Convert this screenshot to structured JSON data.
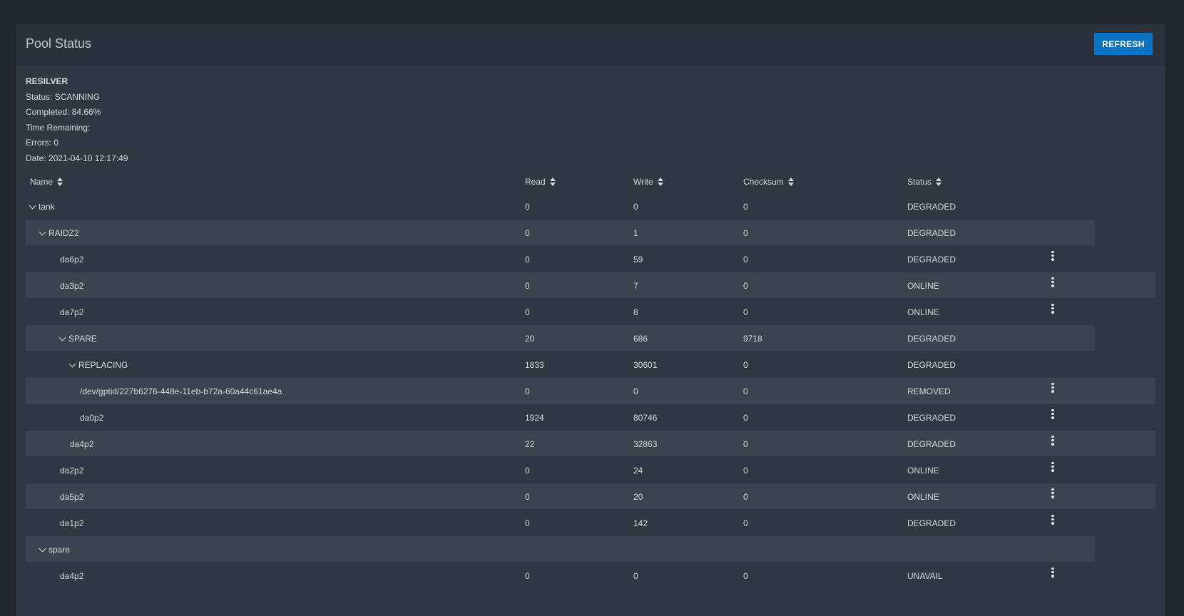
{
  "card": {
    "title": "Pool Status",
    "refresh_label": "REFRESH"
  },
  "scan": {
    "title": "RESILVER",
    "status": "Status: SCANNING",
    "completed": "Completed: 84.66%",
    "time_remaining": "Time Remaining:",
    "errors": "Errors: 0",
    "date": "Date: 2021-04-10 12:17:49"
  },
  "table": {
    "columns": [
      "Name",
      "Read",
      "Write",
      "Checksum",
      "Status"
    ],
    "rows": [
      {
        "name": "tank",
        "read": "0",
        "write": "0",
        "checksum": "0",
        "status": "DEGRADED",
        "depth": 0,
        "expandable": true,
        "menu": false,
        "striped": false,
        "wide": false
      },
      {
        "name": "RAIDZ2",
        "read": "0",
        "write": "1",
        "checksum": "0",
        "status": "DEGRADED",
        "depth": 1,
        "expandable": true,
        "menu": false,
        "striped": true,
        "wide": false
      },
      {
        "name": "da6p2",
        "read": "0",
        "write": "59",
        "checksum": "0",
        "status": "DEGRADED",
        "depth": 2,
        "expandable": false,
        "menu": true,
        "striped": false,
        "wide": true
      },
      {
        "name": "da3p2",
        "read": "0",
        "write": "7",
        "checksum": "0",
        "status": "ONLINE",
        "depth": 2,
        "expandable": false,
        "menu": true,
        "striped": true,
        "wide": true
      },
      {
        "name": "da7p2",
        "read": "0",
        "write": "8",
        "checksum": "0",
        "status": "ONLINE",
        "depth": 2,
        "expandable": false,
        "menu": true,
        "striped": false,
        "wide": true
      },
      {
        "name": "SPARE",
        "read": "20",
        "write": "686",
        "checksum": "9718",
        "status": "DEGRADED",
        "depth": 2,
        "expandable": true,
        "menu": false,
        "striped": true,
        "wide": false
      },
      {
        "name": "REPLACING",
        "read": "1833",
        "write": "30601",
        "checksum": "0",
        "status": "DEGRADED",
        "depth": 3,
        "expandable": true,
        "menu": false,
        "striped": false,
        "wide": false
      },
      {
        "name": "/dev/gptid/227b6276-448e-11eb-b72a-60a44c61ae4a",
        "read": "0",
        "write": "0",
        "checksum": "0",
        "status": "REMOVED",
        "depth": 4,
        "expandable": false,
        "menu": true,
        "striped": true,
        "wide": true
      },
      {
        "name": "da0p2",
        "read": "1924",
        "write": "80746",
        "checksum": "0",
        "status": "DEGRADED",
        "depth": 4,
        "expandable": false,
        "menu": true,
        "striped": false,
        "wide": true
      },
      {
        "name": "da4p2",
        "read": "22",
        "write": "32863",
        "checksum": "0",
        "status": "DEGRADED",
        "depth": 3,
        "expandable": false,
        "menu": true,
        "striped": true,
        "wide": true
      },
      {
        "name": "da2p2",
        "read": "0",
        "write": "24",
        "checksum": "0",
        "status": "ONLINE",
        "depth": 2,
        "expandable": false,
        "menu": true,
        "striped": false,
        "wide": true
      },
      {
        "name": "da5p2",
        "read": "0",
        "write": "20",
        "checksum": "0",
        "status": "ONLINE",
        "depth": 2,
        "expandable": false,
        "menu": true,
        "striped": true,
        "wide": true
      },
      {
        "name": "da1p2",
        "read": "0",
        "write": "142",
        "checksum": "0",
        "status": "DEGRADED",
        "depth": 2,
        "expandable": false,
        "menu": true,
        "striped": false,
        "wide": true
      },
      {
        "name": "spare",
        "read": "",
        "write": "",
        "checksum": "",
        "status": "",
        "depth": 1,
        "expandable": true,
        "menu": false,
        "striped": true,
        "wide": false
      },
      {
        "name": "da4p2",
        "read": "0",
        "write": "0",
        "checksum": "0",
        "status": "UNAVAIL",
        "depth": 2,
        "expandable": false,
        "menu": true,
        "striped": false,
        "wide": true
      }
    ]
  }
}
